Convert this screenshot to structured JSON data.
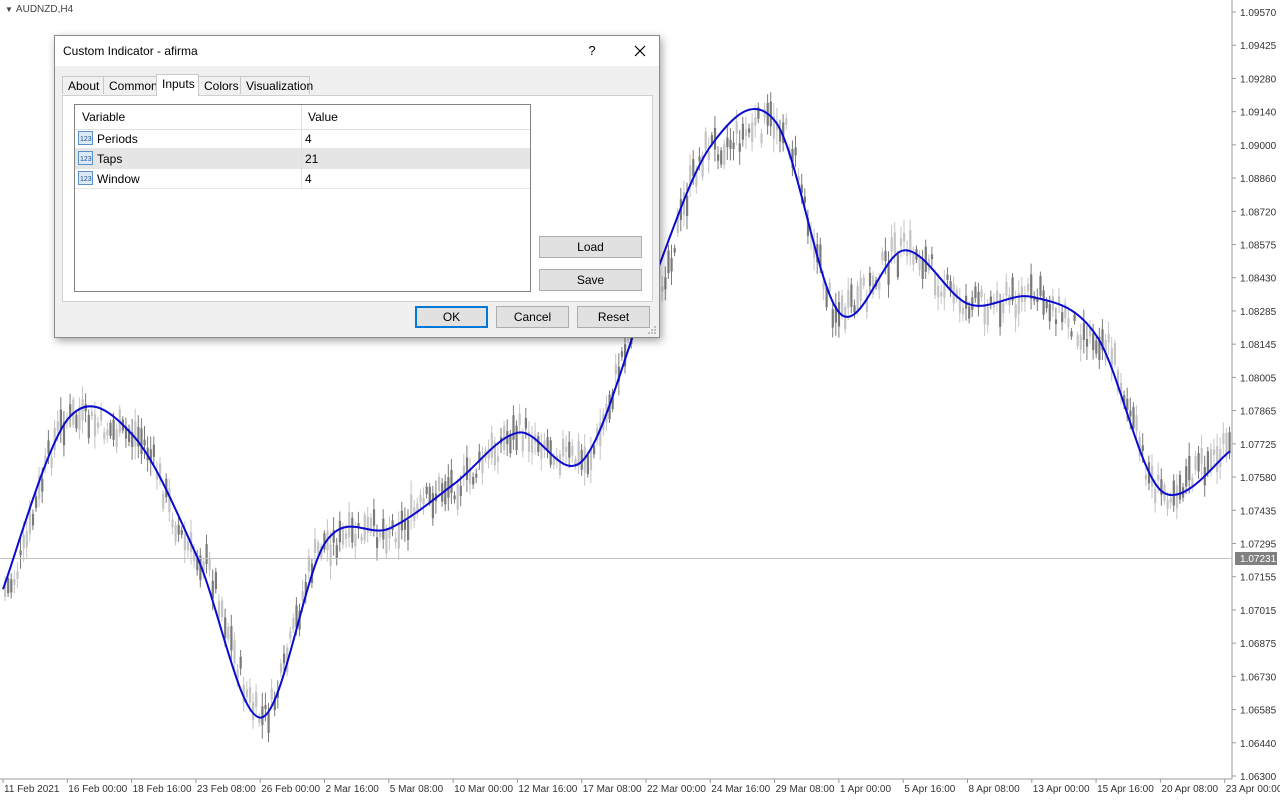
{
  "chart": {
    "symbol": "AUDNZD,H4",
    "current_price": "1.07231",
    "price_axis": [
      "1.09570",
      "1.09425",
      "1.09280",
      "1.09140",
      "1.09000",
      "1.08860",
      "1.08720",
      "1.08575",
      "1.08430",
      "1.08285",
      "1.08145",
      "1.08005",
      "1.07865",
      "1.07725",
      "1.07580",
      "1.07435",
      "1.07295",
      "1.07155",
      "1.07015",
      "1.06875",
      "1.06730",
      "1.06585",
      "1.06440",
      "1.06300"
    ],
    "time_axis": [
      "11 Feb 2021",
      "16 Feb 00:00",
      "18 Feb 16:00",
      "23 Feb 08:00",
      "26 Feb 00:00",
      "2 Mar 16:00",
      "5 Mar 08:00",
      "10 Mar 00:00",
      "12 Mar 16:00",
      "17 Mar 08:00",
      "22 Mar 00:00",
      "24 Mar 16:00",
      "29 Mar 08:00",
      "1 Apr 00:00",
      "5 Apr 16:00",
      "8 Apr 08:00",
      "13 Apr 00:00",
      "15 Apr 16:00",
      "20 Apr 08:00",
      "23 Apr 00:00"
    ],
    "colors": {
      "afirma_line": "#0a0ad2",
      "bar_up": "#7a7a7a",
      "bar_down": "#c4c4c4",
      "price_tag": "#808080"
    }
  },
  "chart_data": {
    "type": "line",
    "series": [
      {
        "x": [
          "11 Feb 2021",
          "16 Feb 00:00",
          "18 Feb 16:00",
          "23 Feb 08:00",
          "26 Feb 00:00",
          "2 Mar 16:00",
          "5 Mar 08:00",
          "10 Mar 00:00",
          "12 Mar 16:00",
          "17 Mar 08:00",
          "22 Mar 00:00",
          "24 Mar 16:00",
          "29 Mar 08:00",
          "1 Apr 00:00",
          "5 Apr 16:00",
          "8 Apr 08:00",
          "13 Apr 00:00",
          "15 Apr 16:00",
          "20 Apr 08:00",
          "23 Apr 00:00"
        ],
        "values": [
          1.071,
          1.0783,
          1.0776,
          1.0724,
          1.0655,
          1.073,
          1.0736,
          1.0755,
          1.0777,
          1.0765,
          1.0835,
          1.09,
          1.091,
          1.0828,
          1.0855,
          1.0832,
          1.0835,
          1.0818,
          1.0752,
          1.0769
        ]
      }
    ],
    "ylim": [
      1.063,
      1.0957
    ],
    "grid": false
  },
  "dialog": {
    "title": "Custom Indicator - afirma",
    "help": "?",
    "tabs": [
      "About",
      "Common",
      "Inputs",
      "Colors",
      "Visualization"
    ],
    "active_tab": "Inputs",
    "table": {
      "headers": [
        "Variable",
        "Value"
      ],
      "rows": [
        {
          "name": "Periods",
          "value": "4"
        },
        {
          "name": "Taps",
          "value": "21"
        },
        {
          "name": "Window",
          "value": "4"
        }
      ]
    },
    "buttons": {
      "load": "Load",
      "save": "Save",
      "ok": "OK",
      "cancel": "Cancel",
      "reset": "Reset"
    }
  }
}
